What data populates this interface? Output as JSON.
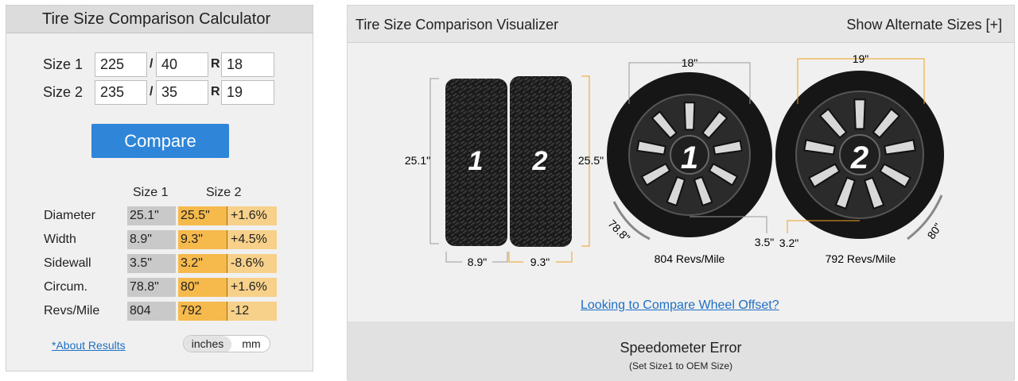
{
  "calculator": {
    "title": "Tire Size Comparison Calculator",
    "size1": {
      "label": "Size 1",
      "width": "225",
      "aspect": "40",
      "rim": "18"
    },
    "size2": {
      "label": "Size 2",
      "width": "235",
      "aspect": "35",
      "rim": "19"
    },
    "separator": "/",
    "rim_prefix": "R",
    "compare_label": "Compare",
    "results": {
      "col1": "Size 1",
      "col2": "Size 2",
      "rows": [
        {
          "label": "Diameter",
          "s1": "25.1\"",
          "s2": "25.5\"",
          "diff": "+1.6%"
        },
        {
          "label": "Width",
          "s1": "8.9\"",
          "s2": "9.3\"",
          "diff": "+4.5%"
        },
        {
          "label": "Sidewall",
          "s1": "3.5\"",
          "s2": "3.2\"",
          "diff": "-8.6%"
        },
        {
          "label": "Circum.",
          "s1": "78.8\"",
          "s2": "80\"",
          "diff": "+1.6%"
        },
        {
          "label": "Revs/Mile",
          "s1": "804",
          "s2": "792",
          "diff": "-12"
        }
      ]
    },
    "about_link": "*About Results",
    "units": {
      "inches": "inches",
      "mm": "mm",
      "selected": "inches"
    }
  },
  "visualizer": {
    "title": "Tire Size Comparison Visualizer",
    "alternate_link": "Show Alternate Sizes [+]",
    "tire1": {
      "number": "1",
      "diameter": "25.1\"",
      "width": "8.9\"",
      "rim": "18\"",
      "sidewall": "3.5\"",
      "circumference": "78.8\"",
      "revs": "804 Revs/Mile"
    },
    "tire2": {
      "number": "2",
      "diameter": "25.5\"",
      "width": "9.3\"",
      "rim": "19\"",
      "sidewall": "3.2\"",
      "circumference": "80\"",
      "revs": "792 Revs/Mile"
    },
    "offset_link": "Looking to Compare Wheel Offset?",
    "speedometer": {
      "title": "Speedometer Error",
      "subtitle": "(Set Size1 to OEM Size)"
    },
    "colors": {
      "size1_line": "#9a9a9a",
      "size2_line": "#f0a020",
      "tire": "#1b1b1b",
      "rim": "#2a2a2a",
      "spoke_face": "#d8d8d8"
    }
  }
}
